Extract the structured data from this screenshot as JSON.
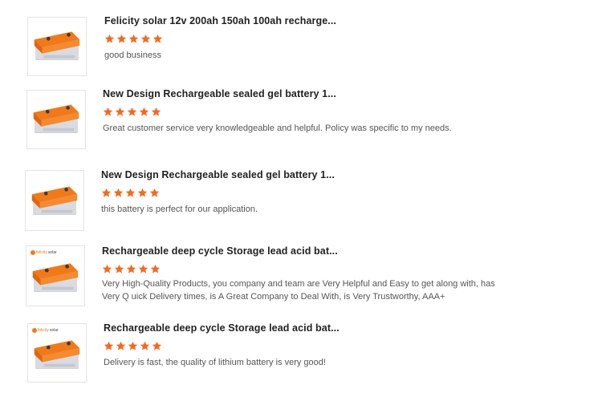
{
  "reviews": [
    {
      "title": "Felicity solar 12v 200ah 150ah 100ah recharge...",
      "rating": 5,
      "comment": "good business",
      "image": "orange-gel-battery-icon",
      "brand_logo": false
    },
    {
      "title": "New Design Rechargeable sealed gel battery 1...",
      "rating": 5,
      "comment": "Great customer service very knowledgeable and helpful. Policy was specific to my needs.",
      "image": "orange-gel-battery-icon",
      "brand_logo": false
    },
    {
      "title": "New Design Rechargeable sealed gel battery 1...",
      "rating": 5,
      "comment": "this battery is perfect for our application.",
      "image": "orange-gel-battery-icon",
      "brand_logo": false
    },
    {
      "title": "Rechargeable deep cycle Storage lead acid bat...",
      "rating": 5,
      "comment": "Very High-Quality Products, you company and team are Very Helpful and Easy to get along with, has Very Q uick Delivery times, is A Great Company to Deal With, is Very Trustworthy, AAA+",
      "image": "orange-gel-battery-icon",
      "brand_logo": true
    },
    {
      "title": "Rechargeable deep cycle Storage lead acid bat...",
      "rating": 5,
      "comment": "Delivery is fast, the quality of lithium battery is very good!",
      "image": "orange-gel-battery-icon",
      "brand_logo": true
    }
  ],
  "colors": {
    "star": "#f26a21",
    "battery_top": "#f07a1a",
    "battery_body": "#d9dbe0"
  }
}
